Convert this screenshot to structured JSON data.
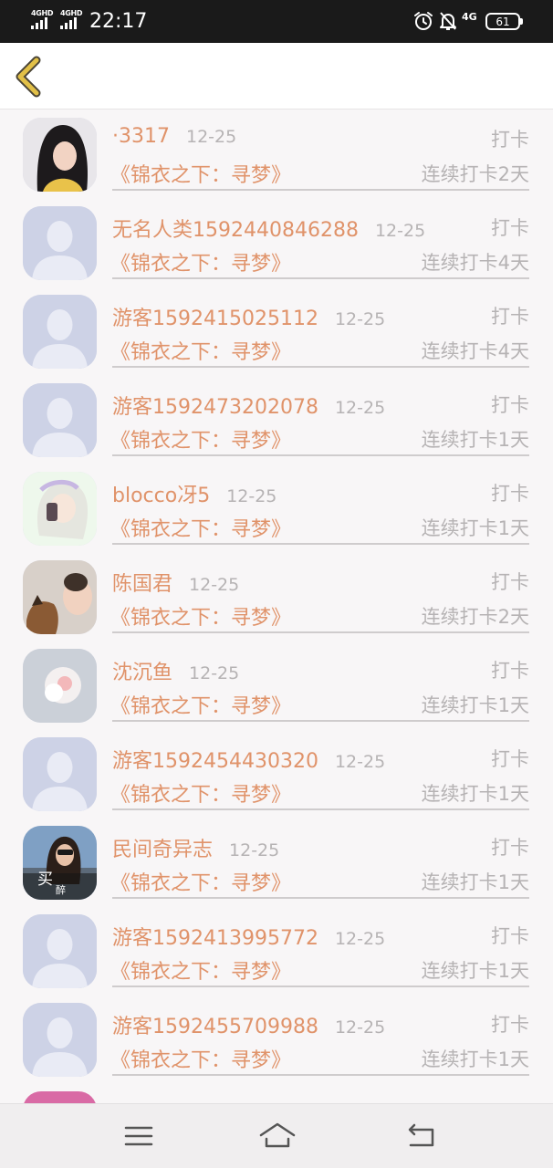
{
  "status_bar": {
    "network_1": "4GHD",
    "network_2": "4GHD",
    "time": "22:17",
    "network_type": "4G",
    "battery": "61",
    "icons": [
      "alarm-icon",
      "mute-icon"
    ]
  },
  "header": {
    "back_icon": "chevron-left-icon",
    "accent_color": "#e2c047"
  },
  "colors": {
    "name": "#e0936a",
    "meta": "#b6b3b4",
    "divider": "#cfcccd"
  },
  "list": {
    "items": [
      {
        "name": "·3317",
        "date": "12-25",
        "action": "打卡",
        "book": "《锦衣之下：寻梦》",
        "streak": "连续打卡2天",
        "avatar": "photo-girl"
      },
      {
        "name": "无名人类1592440846288",
        "date": "12-25",
        "action": "打卡",
        "book": "《锦衣之下：寻梦》",
        "streak": "连续打卡4天",
        "avatar": "default"
      },
      {
        "name": "游客1592415025112",
        "date": "12-25",
        "action": "打卡",
        "book": "《锦衣之下：寻梦》",
        "streak": "连续打卡4天",
        "avatar": "default"
      },
      {
        "name": "游客1592473202078",
        "date": "12-25",
        "action": "打卡",
        "book": "《锦衣之下：寻梦》",
        "streak": "连续打卡1天",
        "avatar": "default"
      },
      {
        "name": "blocco冴5",
        "date": "12-25",
        "action": "打卡",
        "book": "《锦衣之下：寻梦》",
        "streak": "连续打卡1天",
        "avatar": "anime"
      },
      {
        "name": "陈国君",
        "date": "12-25",
        "action": "打卡",
        "book": "《锦衣之下：寻梦》",
        "streak": "连续打卡2天",
        "avatar": "baby-dog"
      },
      {
        "name": "沈沉鱼",
        "date": "12-25",
        "action": "打卡",
        "book": "《锦衣之下：寻梦》",
        "streak": "连续打卡1天",
        "avatar": "flower"
      },
      {
        "name": "游客1592454430320",
        "date": "12-25",
        "action": "打卡",
        "book": "《锦衣之下：寻梦》",
        "streak": "连续打卡1天",
        "avatar": "default"
      },
      {
        "name": "民间奇异志",
        "date": "12-25",
        "action": "打卡",
        "book": "《锦衣之下：寻梦》",
        "streak": "连续打卡1天",
        "avatar": "photo-woman",
        "avatar_text": [
          "买",
          "醉"
        ]
      },
      {
        "name": "游客1592413995772",
        "date": "12-25",
        "action": "打卡",
        "book": "《锦衣之下：寻梦》",
        "streak": "连续打卡1天",
        "avatar": "default"
      },
      {
        "name": "游客1592455709988",
        "date": "12-25",
        "action": "打卡",
        "book": "《锦衣之下：寻梦》",
        "streak": "连续打卡1天",
        "avatar": "default"
      }
    ]
  },
  "nav": {
    "menu_icon": "menu-icon",
    "home_icon": "home-icon",
    "back_icon": "back-icon"
  }
}
